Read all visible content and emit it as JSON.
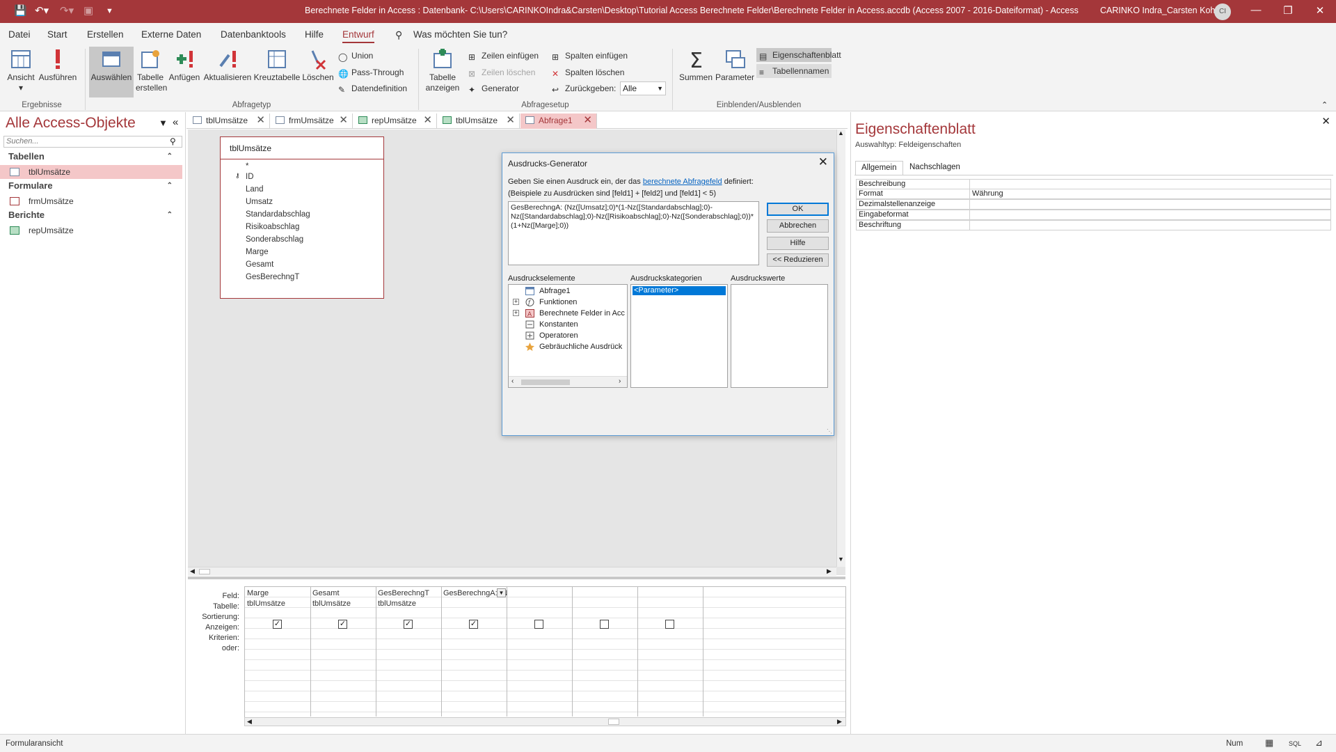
{
  "titlebar": {
    "title": "Berechnete Felder in Access : Datenbank- C:\\Users\\CARINKOIndra&Carsten\\Desktop\\Tutorial Access Berechnete Felder\\Berechnete Felder in Access.accdb (Access 2007 - 2016-Dateiformat) - Access",
    "user": "CARINKO Indra_Carsten Kohl",
    "avatar": "CI"
  },
  "ribbon_tabs": [
    "Datei",
    "Start",
    "Erstellen",
    "Externe Daten",
    "Datenbanktools",
    "Hilfe",
    "Entwurf"
  ],
  "tell_me": "Was möchten Sie tun?",
  "ribbon": {
    "ansicht": "Ansicht",
    "ausfuehren": "Ausführen",
    "auswaehlen": "Auswählen",
    "tabelle_erstellen": "Tabelle erstellen",
    "anfuegen": "Anfügen",
    "aktualisieren": "Aktualisieren",
    "kreuztabelle": "Kreuztabelle",
    "loeschen": "Löschen",
    "union": "Union",
    "pass_through": "Pass-Through",
    "datendefinition": "Datendefinition",
    "tabelle_anzeigen": "Tabelle anzeigen",
    "zeilen_einfuegen": "Zeilen einfügen",
    "zeilen_loeschen": "Zeilen löschen",
    "generator": "Generator",
    "spalten_einfuegen": "Spalten einfügen",
    "spalten_loeschen": "Spalten löschen",
    "zurueckgeben": "Zurückgeben:",
    "zurueckgeben_value": "Alle",
    "summen": "Summen",
    "parameter": "Parameter",
    "eigenschaftenblatt": "Eigenschaftenblatt",
    "tabellennamen": "Tabellennamen",
    "groups": [
      "Ergebnisse",
      "Abfragetyp",
      "Abfragesetup",
      "Einblenden/Ausblenden"
    ]
  },
  "nav": {
    "title": "Alle Access-Objekte",
    "search_placeholder": "Suchen...",
    "sections": [
      {
        "label": "Tabellen",
        "items": [
          "tblUmsätze"
        ]
      },
      {
        "label": "Formulare",
        "items": [
          "frmUmsätze"
        ]
      },
      {
        "label": "Berichte",
        "items": [
          "repUmsätze"
        ]
      }
    ]
  },
  "doc_tabs": [
    "tblUmsätze",
    "frmUmsätze",
    "repUmsätze",
    "tblUmsätze",
    "Abfrage1"
  ],
  "table_box": {
    "title": "tblUmsätze",
    "fields": [
      "*",
      "ID",
      "Land",
      "Umsatz",
      "Standardabschlag",
      "Risikoabschlag",
      "Sonderabschlag",
      "Marge",
      "Gesamt",
      "GesBerechngT"
    ]
  },
  "dialog": {
    "title": "Ausdrucks-Generator",
    "prompt_pre": "Geben Sie einen Ausdruck ein, der das",
    "prompt_link": "berechnete Abfragefeld",
    "prompt_post": "definiert:",
    "example": "(Beispiele zu Ausdrücken sind [feld1] + [feld2] und [feld1] < 5)",
    "expression": "GesBerechngA: (Nz([Umsatz];0)*(1-Nz([Standardabschlag];0)-Nz([Standardabschlag];0)-Nz([Risikoabschlag];0)-Nz([Sonderabschlag];0))*(1+Nz([Marge];0))",
    "ok": "OK",
    "cancel": "Abbrechen",
    "help": "Hilfe",
    "reduce": "<< Reduzieren",
    "elements_label": "Ausdruckselemente",
    "categories_label": "Ausdruckskategorien",
    "values_label": "Ausdruckswerte",
    "elements": [
      "Abfrage1",
      "Funktionen",
      "Berechnete Felder in Acc",
      "Konstanten",
      "Operatoren",
      "Gebräuchliche Ausdrück"
    ],
    "categories": [
      "<Parameter>"
    ]
  },
  "property_sheet": {
    "title": "Eigenschaftenblatt",
    "selection_type": "Auswahltyp:  Feldeigenschaften",
    "tabs": [
      "Allgemein",
      "Nachschlagen"
    ],
    "rows": [
      {
        "key": "Beschreibung",
        "value": ""
      },
      {
        "key": "Format",
        "value": "Währung"
      },
      {
        "key": "Dezimalstellenanzeige",
        "value": ""
      },
      {
        "key": "Eingabeformat",
        "value": ""
      },
      {
        "key": "Beschriftung",
        "value": ""
      }
    ]
  },
  "grid": {
    "row_labels": [
      "Feld:",
      "Tabelle:",
      "Sortierung:",
      "Anzeigen:",
      "Kriterien:",
      "oder:"
    ],
    "columns": [
      {
        "field": "Marge",
        "table": "tblUmsätze",
        "show": true
      },
      {
        "field": "Gesamt",
        "table": "tblUmsätze",
        "show": true
      },
      {
        "field": "GesBerechngT",
        "table": "tblUmsätze",
        "show": true
      },
      {
        "field": "GesBerechngA: (N",
        "table": "",
        "show": true
      },
      {
        "field": "",
        "table": "",
        "show": false
      },
      {
        "field": "",
        "table": "",
        "show": false
      },
      {
        "field": "",
        "table": "",
        "show": false
      }
    ]
  },
  "status": {
    "left": "Formularansicht",
    "num": "Num"
  },
  "colors": {
    "accent": "#a4373a",
    "selection": "#f4c7c8",
    "link": "#0563c1"
  }
}
